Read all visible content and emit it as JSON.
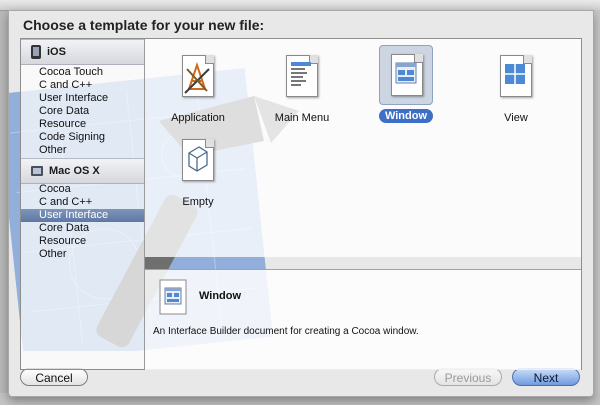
{
  "dialog": {
    "title": "Choose a template for your new file:"
  },
  "sidebar": {
    "groups": [
      {
        "label": "iOS",
        "items": [
          "Cocoa Touch",
          "C and C++",
          "User Interface",
          "Core Data",
          "Resource",
          "Code Signing",
          "Other"
        ]
      },
      {
        "label": "Mac OS X",
        "items": [
          "Cocoa",
          "C and C++",
          "User Interface",
          "Core Data",
          "Resource",
          "Other"
        ]
      }
    ],
    "selected": "Mac OS X / User Interface"
  },
  "templates": [
    {
      "label": "Application",
      "icon": "application-template-icon",
      "selected": false
    },
    {
      "label": "Main Menu",
      "icon": "main-menu-template-icon",
      "selected": false
    },
    {
      "label": "Window",
      "icon": "window-template-icon",
      "selected": true
    },
    {
      "label": "View",
      "icon": "view-template-icon",
      "selected": false
    },
    {
      "label": "Empty",
      "icon": "empty-template-icon",
      "selected": false
    }
  ],
  "description": {
    "title": "Window",
    "text": "An Interface Builder document for creating a Cocoa window."
  },
  "buttons": {
    "cancel": "Cancel",
    "previous": "Previous",
    "next": "Next"
  },
  "colors": {
    "selection_blue": "#3d6fc7",
    "sidebar_selected": "#6b82ad",
    "blueprint": "#4a7fd0"
  }
}
